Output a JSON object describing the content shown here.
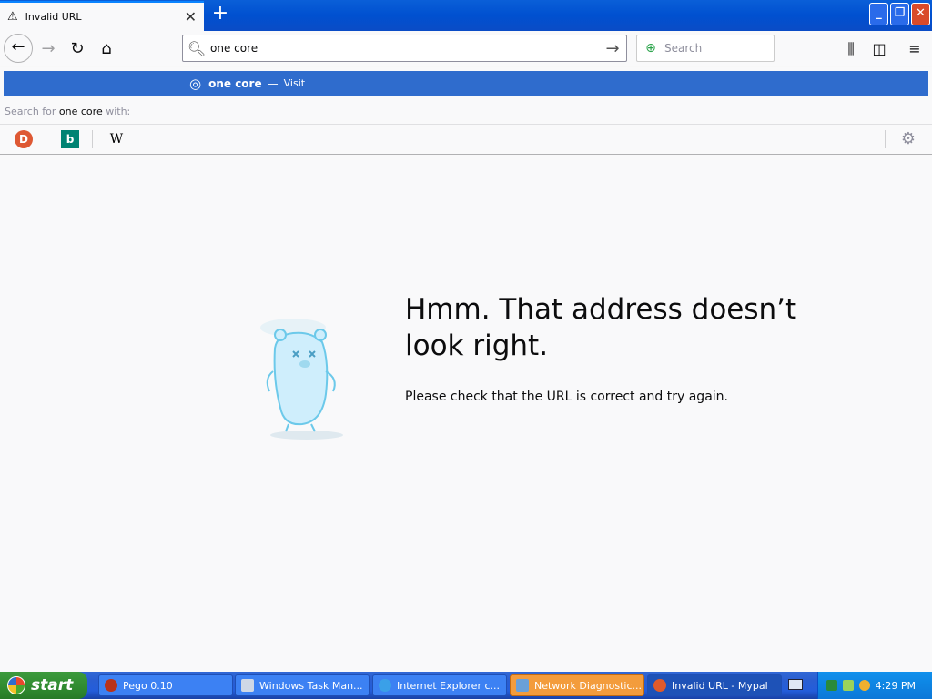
{
  "browser": {
    "tab": {
      "title": "Invalid URL",
      "close_glyph": "✕"
    },
    "new_tab_glyph": "+",
    "window_buttons": {
      "minimize": "_",
      "maximize": "❐",
      "close": "✕"
    }
  },
  "navbar": {
    "back": "←",
    "forward": "→",
    "reload": "↻",
    "home": "⌂",
    "url_value": "one core",
    "go": "→",
    "search_placeholder": "Search",
    "library": "⫼",
    "sidebar": "◫",
    "menu": "≡"
  },
  "autocomplete": {
    "suggestion": {
      "title": "one core",
      "dash": "—",
      "action": "Visit"
    },
    "search_for_prefix": "Search for",
    "search_for_term": "one core",
    "search_for_suffix": "with:",
    "engines": {
      "ddg": "D",
      "bing": "b",
      "wiki": "W",
      "settings": "⚙"
    }
  },
  "error_page": {
    "title": "Hmm. That address doesn’t look right.",
    "description": "Please check that the URL is correct and try again."
  },
  "taskbar": {
    "start": "start",
    "tasks": [
      {
        "label": "Pego 0.10"
      },
      {
        "label": "Windows Task Man..."
      },
      {
        "label": "Internet Explorer c..."
      },
      {
        "label": "Network Diagnostic..."
      },
      {
        "label": "Invalid URL - Mypal"
      }
    ],
    "clock": "4:29 PM"
  }
}
